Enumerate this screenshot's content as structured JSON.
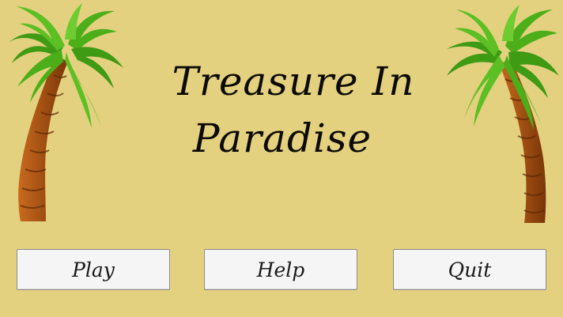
{
  "game": {
    "title_line_1": "Treasure In",
    "title_line_2": "Paradise"
  },
  "menu": {
    "play_label": "Play",
    "help_label": "Help",
    "quit_label": "Quit"
  },
  "colors": {
    "background": "#e3d17f",
    "title_text": "#0c0a06",
    "button_face": "#f5f5f5",
    "button_border": "#8c8c8c",
    "trunk": "#9b4a12",
    "leaf": "#4caf1a"
  },
  "icons": {
    "left_decoration": "palm-tree-icon",
    "right_decoration": "palm-tree-icon"
  }
}
